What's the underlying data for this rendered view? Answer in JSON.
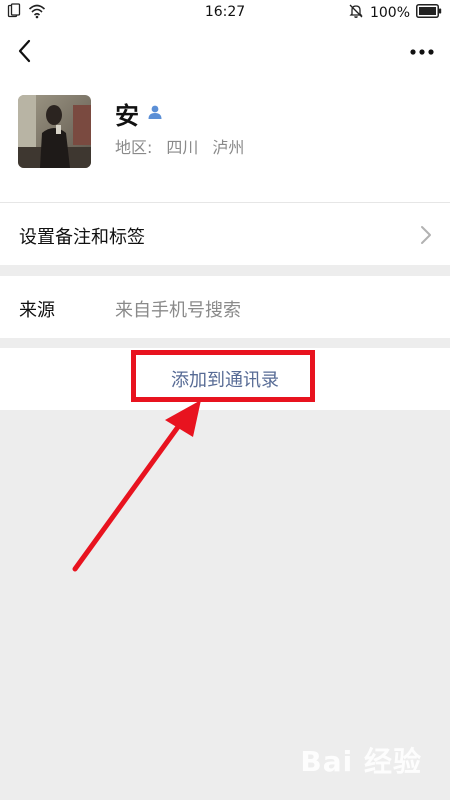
{
  "status_bar": {
    "time": "16:27",
    "battery_text": "100%",
    "icons": [
      "sim-card-icon",
      "wifi-icon",
      "bell-muted-icon",
      "battery-icon"
    ]
  },
  "nav": {
    "back_icon": "back-arrow-icon",
    "more_icon": "more-dots-icon"
  },
  "profile": {
    "name": "安",
    "badge_icon": "person-verified-icon",
    "region_label": "地区:",
    "region_province": "四川",
    "region_city": "泸州"
  },
  "rows": {
    "remark_label": "设置备注和标签",
    "source_label": "来源",
    "source_value": "来自手机号搜索"
  },
  "action": {
    "add_label": "添加到通讯录"
  },
  "annotation": {
    "highlight_color": "#e8131f"
  },
  "watermark": {
    "text": "Bai 经验"
  },
  "colors": {
    "link_blue": "#576b95",
    "background_gray": "#ededed",
    "secondary_text": "#8a8a8a"
  }
}
